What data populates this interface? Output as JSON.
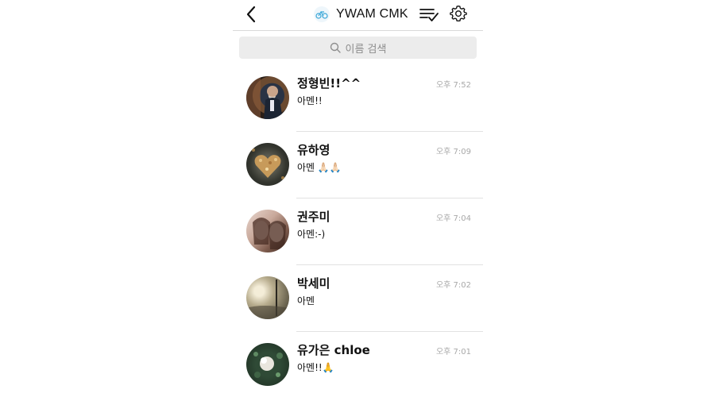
{
  "header": {
    "title": "YWAM CMK",
    "logo_icon": "bicycle-logo-icon",
    "back_icon": "chevron-left-icon",
    "edit_icon": "list-check-icon",
    "settings_icon": "gear-icon"
  },
  "search": {
    "placeholder": "이름 검색"
  },
  "chats": [
    {
      "name": "정형빈!!^^",
      "message": "아멘!!",
      "time": "오후 7:52"
    },
    {
      "name": "유하영",
      "message": "아멘 🙏🏻🙏🏻",
      "time": "오후 7:09"
    },
    {
      "name": "권주미",
      "message": "아멘:-)",
      "time": "오후 7:04"
    },
    {
      "name": "박세미",
      "message": "아멘",
      "time": "오후 7:02"
    },
    {
      "name": "유가은 chloe",
      "message": "아멘!!🙏",
      "time": "오후 7:01"
    }
  ],
  "colors": {
    "divider": "#e2e2e2",
    "search_bg": "#ececec",
    "time": "#a8a8a8",
    "logo_accent": "#3aa7d8"
  }
}
